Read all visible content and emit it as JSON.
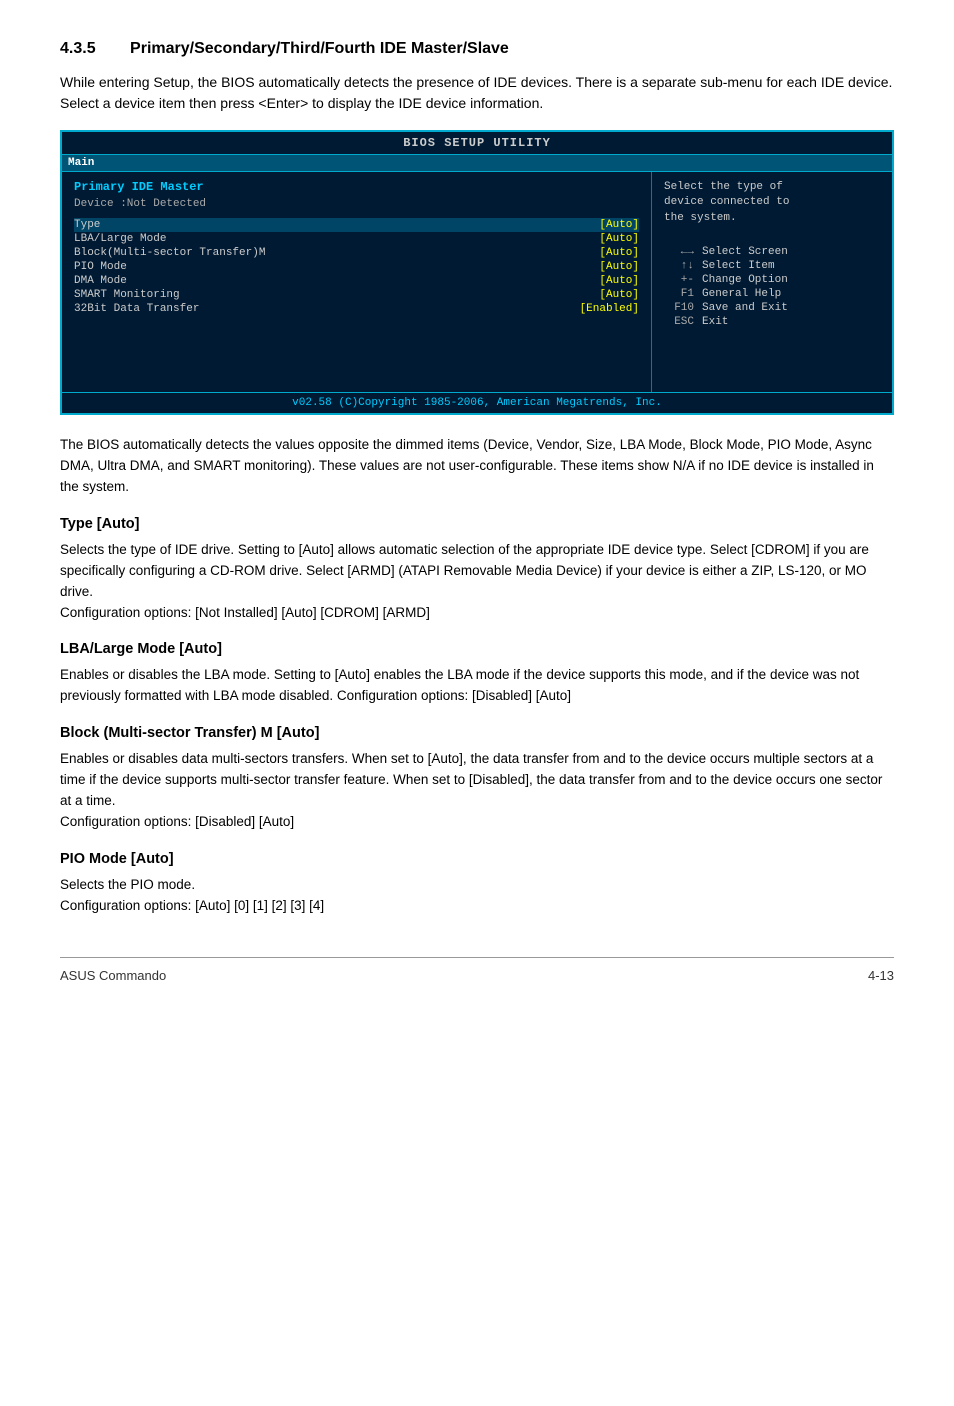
{
  "section": {
    "number": "4.3.5",
    "title": "Primary/Secondary/Third/Fourth IDE Master/Slave"
  },
  "intro": "While entering Setup, the BIOS automatically detects the presence of IDE devices. There is a separate sub-menu for each IDE device. Select a device item then press <Enter> to display the IDE device information.",
  "bios_box": {
    "title": "BIOS SETUP UTILITY",
    "tab": "Main",
    "section_title": "Primary IDE Master",
    "device_line": "Device      :Not Detected",
    "items": [
      {
        "label": "Type",
        "value": "[Auto]"
      },
      {
        "label": "LBA/Large Mode",
        "value": "[Auto]"
      },
      {
        "label": "Block(Multi-sector Transfer)M",
        "value": "[Auto]"
      },
      {
        "label": "PIO Mode",
        "value": "[Auto]"
      },
      {
        "label": "DMA Mode",
        "value": "[Auto]"
      },
      {
        "label": "SMART Monitoring",
        "value": "[Auto]"
      },
      {
        "label": "32Bit Data Transfer",
        "value": "[Enabled]"
      }
    ],
    "help_text": "Select the type of\ndevice connected to\nthe system.",
    "nav": [
      {
        "key": "←→",
        "desc": "Select Screen"
      },
      {
        "key": "↑↓",
        "desc": "Select Item"
      },
      {
        "key": "+-",
        "desc": "Change Option"
      },
      {
        "key": "F1",
        "desc": "General Help"
      },
      {
        "key": "F10",
        "desc": "Save and Exit"
      },
      {
        "key": "ESC",
        "desc": "Exit"
      }
    ],
    "footer": "v02.58  (C)Copyright 1985-2006, American Megatrends, Inc."
  },
  "body_paragraph": "The BIOS automatically detects the values opposite the dimmed items (Device, Vendor, Size, LBA Mode, Block Mode, PIO Mode, Async DMA, Ultra DMA, and SMART monitoring). These values are not user-configurable. These items show N/A if no IDE device is installed in the system.",
  "subsections": [
    {
      "id": "type-auto",
      "heading": "Type [Auto]",
      "text": "Selects the type of IDE drive. Setting to [Auto] allows automatic selection of the appropriate IDE device type. Select [CDROM] if you are specifically configuring a CD-ROM drive. Select [ARMD] (ATAPI Removable Media Device) if your device is either a ZIP, LS-120, or MO drive.\nConfiguration options: [Not Installed] [Auto] [CDROM] [ARMD]"
    },
    {
      "id": "lba-large-mode",
      "heading": "LBA/Large Mode [Auto]",
      "text": "Enables or disables the LBA mode. Setting to [Auto] enables the LBA mode if the device supports this mode, and if the device was not previously formatted with LBA mode disabled. Configuration options: [Disabled] [Auto]"
    },
    {
      "id": "block-multi-sector",
      "heading": "Block (Multi-sector Transfer) M [Auto]",
      "text": "Enables or disables data multi-sectors transfers. When set to [Auto], the data transfer from and to the device occurs multiple sectors at a time if the device supports multi-sector transfer feature. When set to [Disabled], the data transfer from and to the device occurs one sector at a time.\nConfiguration options: [Disabled] [Auto]"
    },
    {
      "id": "pio-mode",
      "heading": "PIO Mode [Auto]",
      "text": "Selects the PIO mode.\nConfiguration options: [Auto] [0] [1] [2] [3] [4]"
    }
  ],
  "footer": {
    "brand": "ASUS Commando",
    "page": "4-13"
  }
}
